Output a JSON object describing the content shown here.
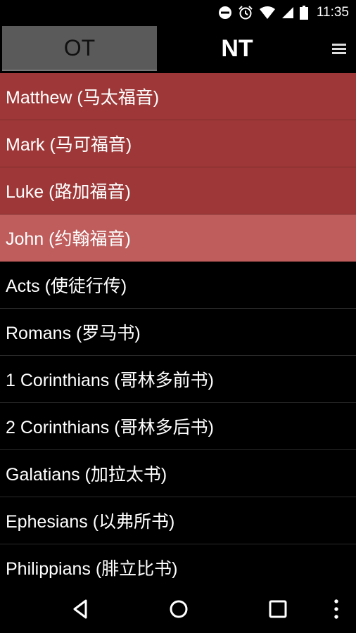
{
  "status_bar": {
    "time": "11:35",
    "icons": [
      "do-not-disturb-icon",
      "alarm-icon",
      "wifi-icon",
      "signal-icon",
      "battery-icon"
    ]
  },
  "tabs": {
    "ot_label": "OT",
    "nt_label": "NT",
    "menu_icon": "menu-icon"
  },
  "books": [
    {
      "label": "Matthew (马太福音)",
      "style": "gospel"
    },
    {
      "label": "Mark (马可福音)",
      "style": "gospel"
    },
    {
      "label": "Luke (路加福音)",
      "style": "gospel"
    },
    {
      "label": "John (约翰福音)",
      "style": "selected"
    },
    {
      "label": "Acts (使徒行传)",
      "style": "normal"
    },
    {
      "label": "Romans (罗马书)",
      "style": "normal"
    },
    {
      "label": "1 Corinthians (哥林多前书)",
      "style": "normal"
    },
    {
      "label": "2 Corinthians (哥林多后书)",
      "style": "normal"
    },
    {
      "label": "Galatians (加拉太书)",
      "style": "normal"
    },
    {
      "label": "Ephesians (以弗所书)",
      "style": "normal"
    },
    {
      "label": "Philippians (腓立比书)",
      "style": "normal"
    }
  ],
  "colors": {
    "gospel_row": "#9e3838",
    "selected_row": "#bf5d5d",
    "background": "#000000",
    "inactive_tab": "#5a5a5a"
  },
  "nav_bar": {
    "icons": [
      "back-icon",
      "home-icon",
      "recents-icon",
      "more-icon"
    ]
  }
}
